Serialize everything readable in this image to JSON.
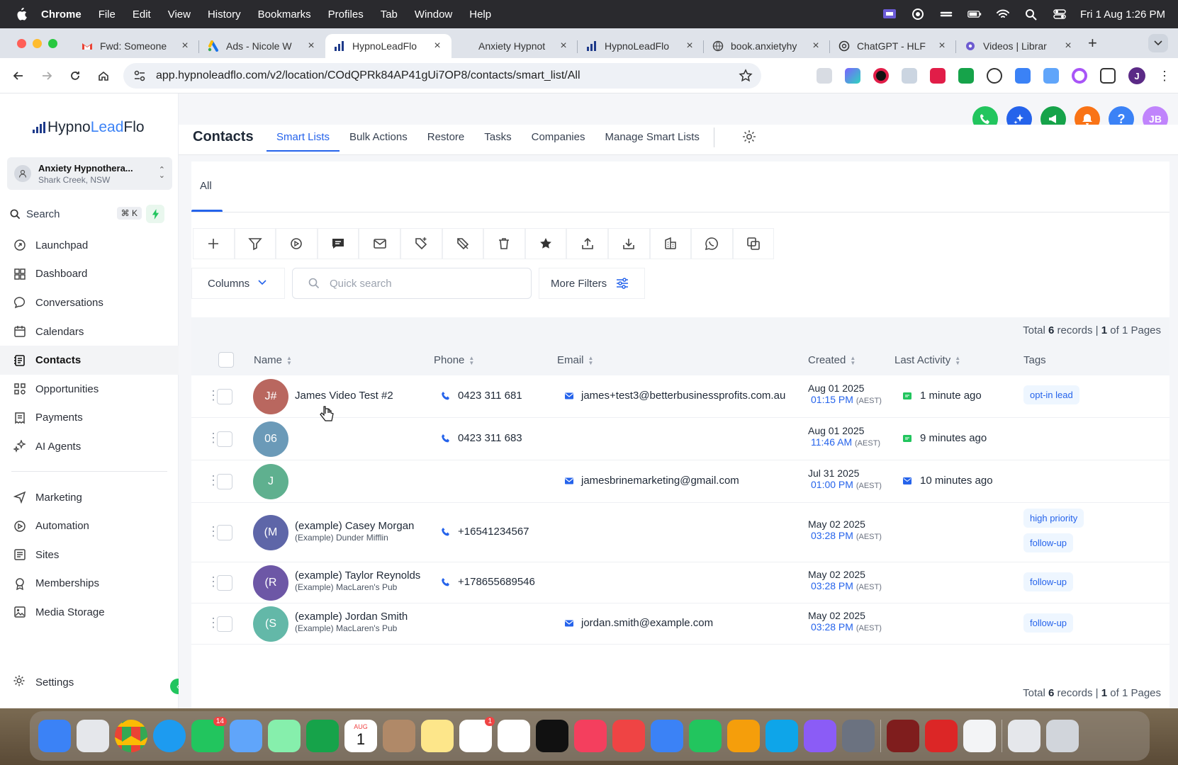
{
  "menubar": {
    "app": "Chrome",
    "items": [
      "File",
      "Edit",
      "View",
      "History",
      "Bookmarks",
      "Profiles",
      "Tab",
      "Window",
      "Help"
    ],
    "clock": "Fri 1 Aug  1:26 PM"
  },
  "tabs": [
    {
      "label": "Fwd: Someone",
      "favicon": "gmail-icon",
      "active": false
    },
    {
      "label": "Ads - Nicole W",
      "favicon": "google-ads-icon",
      "active": false
    },
    {
      "label": "HypnoLeadFlo",
      "favicon": "hypnoleadflo-icon",
      "active": true
    },
    {
      "label": "Anxiety Hypnot",
      "favicon": "",
      "active": false
    },
    {
      "label": "HypnoLeadFlo",
      "favicon": "hypnoleadflo-icon",
      "active": false
    },
    {
      "label": "book.anxietyhy",
      "favicon": "globe-icon",
      "active": false
    },
    {
      "label": "ChatGPT - HLF",
      "favicon": "chatgpt-icon",
      "active": false
    },
    {
      "label": "Videos | Librar",
      "favicon": "gear-flower-icon",
      "active": false
    }
  ],
  "address": {
    "url": "app.hypnoleadflo.com/v2/location/COdQPRk84AP41gUi7OP8/contacts/smart_list/All"
  },
  "profile_initial": "J",
  "brand": {
    "name_a": "Hypno",
    "name_b": "Lead",
    "name_c": "Flo"
  },
  "account": {
    "name": "Anxiety Hypnothera...",
    "location": "Shark Creek, NSW"
  },
  "sidebar": {
    "search_label": "Search",
    "search_shortcut": "⌘ K",
    "items": [
      {
        "label": "Launchpad",
        "icon": "launchpad-icon",
        "active": false
      },
      {
        "label": "Dashboard",
        "icon": "dashboard-icon",
        "active": false
      },
      {
        "label": "Conversations",
        "icon": "chat-icon",
        "active": false
      },
      {
        "label": "Calendars",
        "icon": "calendar-icon",
        "active": false
      },
      {
        "label": "Contacts",
        "icon": "contacts-icon",
        "active": true
      },
      {
        "label": "Opportunities",
        "icon": "opportunities-icon",
        "active": false
      },
      {
        "label": "Payments",
        "icon": "payments-icon",
        "active": false
      },
      {
        "label": "AI Agents",
        "icon": "ai-agents-icon",
        "active": false
      }
    ],
    "items2": [
      {
        "label": "Marketing",
        "icon": "marketing-icon"
      },
      {
        "label": "Automation",
        "icon": "automation-icon"
      },
      {
        "label": "Sites",
        "icon": "sites-icon"
      },
      {
        "label": "Memberships",
        "icon": "memberships-icon"
      },
      {
        "label": "Media Storage",
        "icon": "media-storage-icon"
      }
    ],
    "settings": "Settings"
  },
  "topbar": {
    "user_initials": "JB"
  },
  "page": {
    "title": "Contacts",
    "tabs": [
      "Smart Lists",
      "Bulk Actions",
      "Restore",
      "Tasks",
      "Companies",
      "Manage Smart Lists"
    ],
    "active_tab": "Smart Lists",
    "subtab": "All"
  },
  "toolbar_actions": [
    "add-icon",
    "filter-icon",
    "pipeline-icon",
    "sms-icon",
    "email-icon",
    "add-tag-icon",
    "remove-tag-icon",
    "delete-icon",
    "star-icon",
    "export-icon",
    "import-icon",
    "company-icon",
    "whatsapp-icon",
    "merge-icon"
  ],
  "filters": {
    "columns_label": "Columns",
    "search_placeholder": "Quick search",
    "more_filters_label": "More Filters"
  },
  "table": {
    "total_prefix": "Total",
    "total_count": "6",
    "total_mid": "records |",
    "page": "1",
    "page_suffix": "of 1 Pages",
    "headers": [
      "Name",
      "Phone",
      "Email",
      "Created",
      "Last Activity",
      "Tags"
    ],
    "rows": [
      {
        "initials": "J#",
        "avatar_color": "#b9675f",
        "name": "James Video Test #2",
        "company": "",
        "phone": "0423 311 681",
        "email": "james+test3@betterbusinessprofits.com.au",
        "created_date": "Aug 01 2025",
        "created_time": "01:15 PM",
        "tz": "(AEST)",
        "activity": "1 minute ago",
        "activity_icon": "sms-activity-icon",
        "tags": [
          "opt-in lead"
        ]
      },
      {
        "initials": "06",
        "avatar_color": "#6b9ab8",
        "name": "",
        "company": "",
        "phone": "0423 311 683",
        "email": "",
        "created_date": "Aug 01 2025",
        "created_time": "11:46 AM",
        "tz": "(AEST)",
        "activity": "9 minutes ago",
        "activity_icon": "sms-activity-icon",
        "tags": []
      },
      {
        "initials": "J",
        "avatar_color": "#5fb08f",
        "name": "",
        "company": "",
        "phone": "",
        "email": "jamesbrinemarketing@gmail.com",
        "created_date": "Jul 31 2025",
        "created_time": "01:00 PM",
        "tz": "(AEST)",
        "activity": "10 minutes ago",
        "activity_icon": "email-activity-icon",
        "tags": []
      },
      {
        "initials": "(M",
        "avatar_color": "#5e66a8",
        "name": "(example) Casey Morgan",
        "company": "(Example) Dunder Mifflin",
        "phone": "+16541234567",
        "email": "",
        "created_date": "May 02 2025",
        "created_time": "03:28 PM",
        "tz": "(AEST)",
        "activity": "",
        "activity_icon": "",
        "tags": [
          "high priority",
          "follow-up"
        ]
      },
      {
        "initials": "(R",
        "avatar_color": "#6d57a6",
        "name": "(example) Taylor Reynolds",
        "company": "(Example) MacLaren's Pub",
        "phone": "+178655689546",
        "email": "",
        "created_date": "May 02 2025",
        "created_time": "03:28 PM",
        "tz": "(AEST)",
        "activity": "",
        "activity_icon": "",
        "tags": [
          "follow-up"
        ]
      },
      {
        "initials": "(S",
        "avatar_color": "#63b8a8",
        "name": "(example) Jordan Smith",
        "company": "(Example) MacLaren's Pub",
        "phone": "",
        "email": "jordan.smith@example.com",
        "created_date": "May 02 2025",
        "created_time": "03:28 PM",
        "tz": "(AEST)",
        "activity": "",
        "activity_icon": "",
        "tags": [
          "follow-up"
        ]
      }
    ]
  },
  "colors": {
    "accent": "#2563eb",
    "active_nav_bg": "#f3f4f6",
    "green": "#22c55e"
  },
  "dock": {
    "calendar_month": "AUG",
    "calendar_day": "1",
    "messages_badge": "14",
    "reminders_badge": "1"
  }
}
